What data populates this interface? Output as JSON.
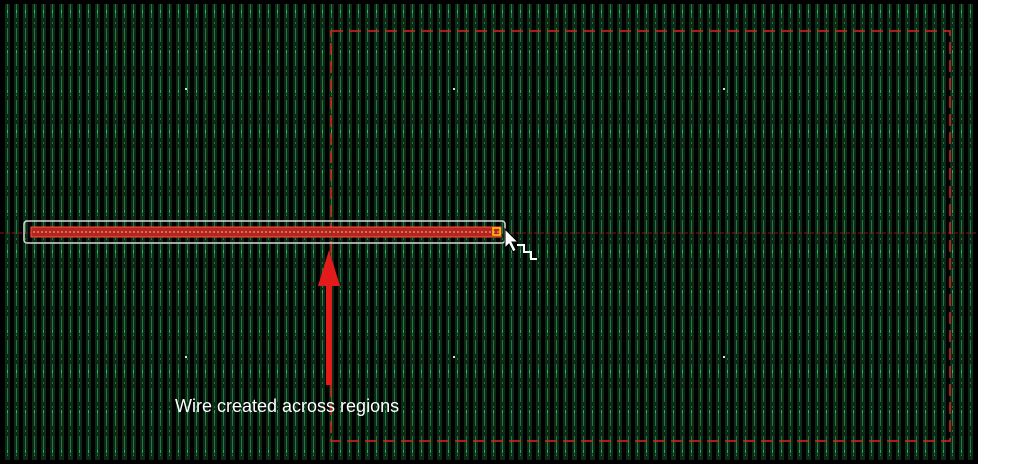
{
  "layout_view": {
    "annotation": "Wire created across regions",
    "colors": {
      "background": "#000000",
      "track": "#1f7a3f",
      "track_light": "#2ecc71",
      "region_boundary": "#d9261c",
      "wire_fill": "#b3261e",
      "wire_highlight": "#ffffff",
      "arrow": "#e31b1b",
      "text": "#ffffff"
    },
    "icons": {
      "cursor": "arrow-cursor-icon",
      "pointer_arrow": "red-up-arrow-icon"
    }
  }
}
